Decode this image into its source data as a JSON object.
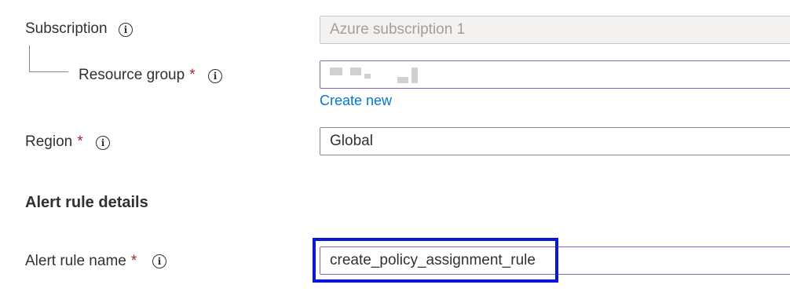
{
  "subscription": {
    "label": "Subscription",
    "value": "Azure subscription 1"
  },
  "resource_group": {
    "label": "Resource group",
    "required_mark": "*",
    "create_new_label": "Create new"
  },
  "region": {
    "label": "Region",
    "required_mark": "*",
    "value": "Global"
  },
  "alert_rule_details": {
    "heading": "Alert rule details"
  },
  "alert_rule_name": {
    "label": "Alert rule name",
    "required_mark": "*",
    "value": "create_policy_assignment_rule"
  },
  "icons": {
    "info": "info-icon",
    "info_glyph": "i"
  },
  "colors": {
    "link": "#0078d4",
    "required": "#a4262c",
    "highlight_box": "#0a18d6",
    "focus_border": "#8764b8"
  }
}
